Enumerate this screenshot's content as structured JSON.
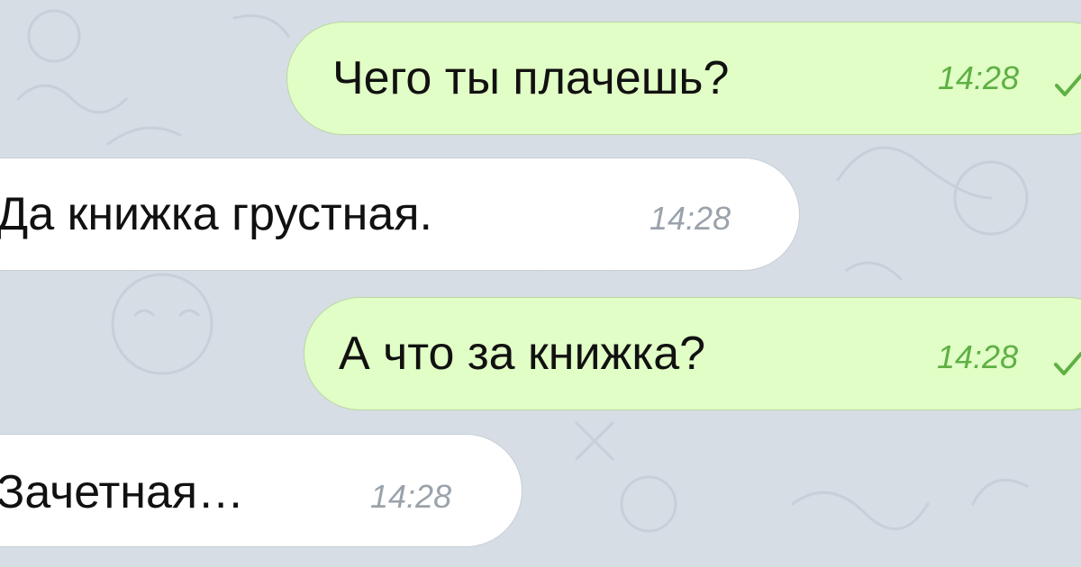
{
  "messages": [
    {
      "direction": "outgoing",
      "text": "Чего ты плачешь?",
      "time": "14:28",
      "status_icon": "check-icon"
    },
    {
      "direction": "incoming",
      "text": "Да книжка грустная.",
      "time": "14:28"
    },
    {
      "direction": "outgoing",
      "text": "А что за книжка?",
      "time": "14:28",
      "status_icon": "check-icon"
    },
    {
      "direction": "incoming",
      "text": "Зачетная…",
      "time": "14:28"
    }
  ],
  "colors": {
    "background": "#d6dde5",
    "outgoing_bubble": "#e1fec6",
    "incoming_bubble": "#ffffff",
    "outgoing_time": "#5fb045",
    "incoming_time": "#9aa3ab"
  }
}
